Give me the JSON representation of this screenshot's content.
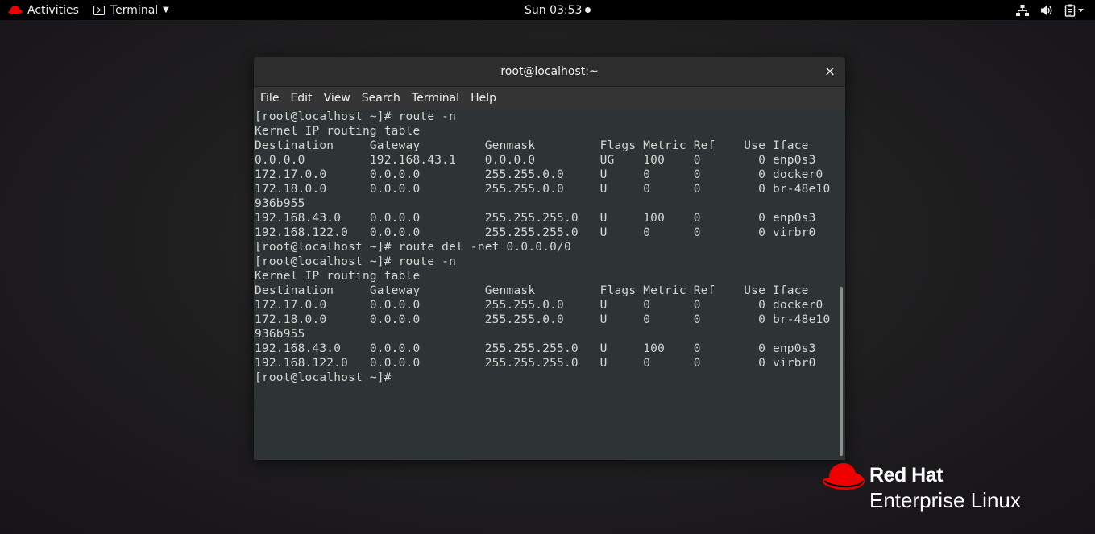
{
  "topbar": {
    "activities_label": "Activities",
    "app_menu_label": "Terminal",
    "clock": "Sun 03:53"
  },
  "window": {
    "title": "root@localhost:~",
    "close_glyph": "×",
    "menu": [
      "File",
      "Edit",
      "View",
      "Search",
      "Terminal",
      "Help"
    ]
  },
  "terminal": {
    "lines": [
      "[root@localhost ~]# route -n",
      "Kernel IP routing table",
      "Destination     Gateway         Genmask         Flags Metric Ref    Use Iface",
      "0.0.0.0         192.168.43.1    0.0.0.0         UG    100    0        0 enp0s3",
      "172.17.0.0      0.0.0.0         255.255.0.0     U     0      0        0 docker0",
      "172.18.0.0      0.0.0.0         255.255.0.0     U     0      0        0 br-48e10",
      "936b955",
      "192.168.43.0    0.0.0.0         255.255.255.0   U     100    0        0 enp0s3",
      "192.168.122.0   0.0.0.0         255.255.255.0   U     0      0        0 virbr0",
      "[root@localhost ~]# route del -net 0.0.0.0/0",
      "[root@localhost ~]# route -n",
      "Kernel IP routing table",
      "Destination     Gateway         Genmask         Flags Metric Ref    Use Iface",
      "172.17.0.0      0.0.0.0         255.255.0.0     U     0      0        0 docker0",
      "172.18.0.0      0.0.0.0         255.255.0.0     U     0      0        0 br-48e10",
      "936b955",
      "192.168.43.0    0.0.0.0         255.255.255.0   U     100    0        0 enp0s3",
      "192.168.122.0   0.0.0.0         255.255.255.0   U     0      0        0 virbr0",
      "[root@localhost ~]#"
    ]
  },
  "branding": {
    "line1": "Red Hat",
    "line2": "Enterprise Linux"
  },
  "colors": {
    "redhat_red": "#ee0000",
    "terminal_bg": "#2e3436",
    "terminal_fg": "#d3d7cf"
  },
  "icons": {
    "activities": "redhat-hat-icon",
    "app_menu": "terminal-icon",
    "network": "network-icon",
    "volume": "volume-icon",
    "clipboard": "clipboard-icon"
  }
}
